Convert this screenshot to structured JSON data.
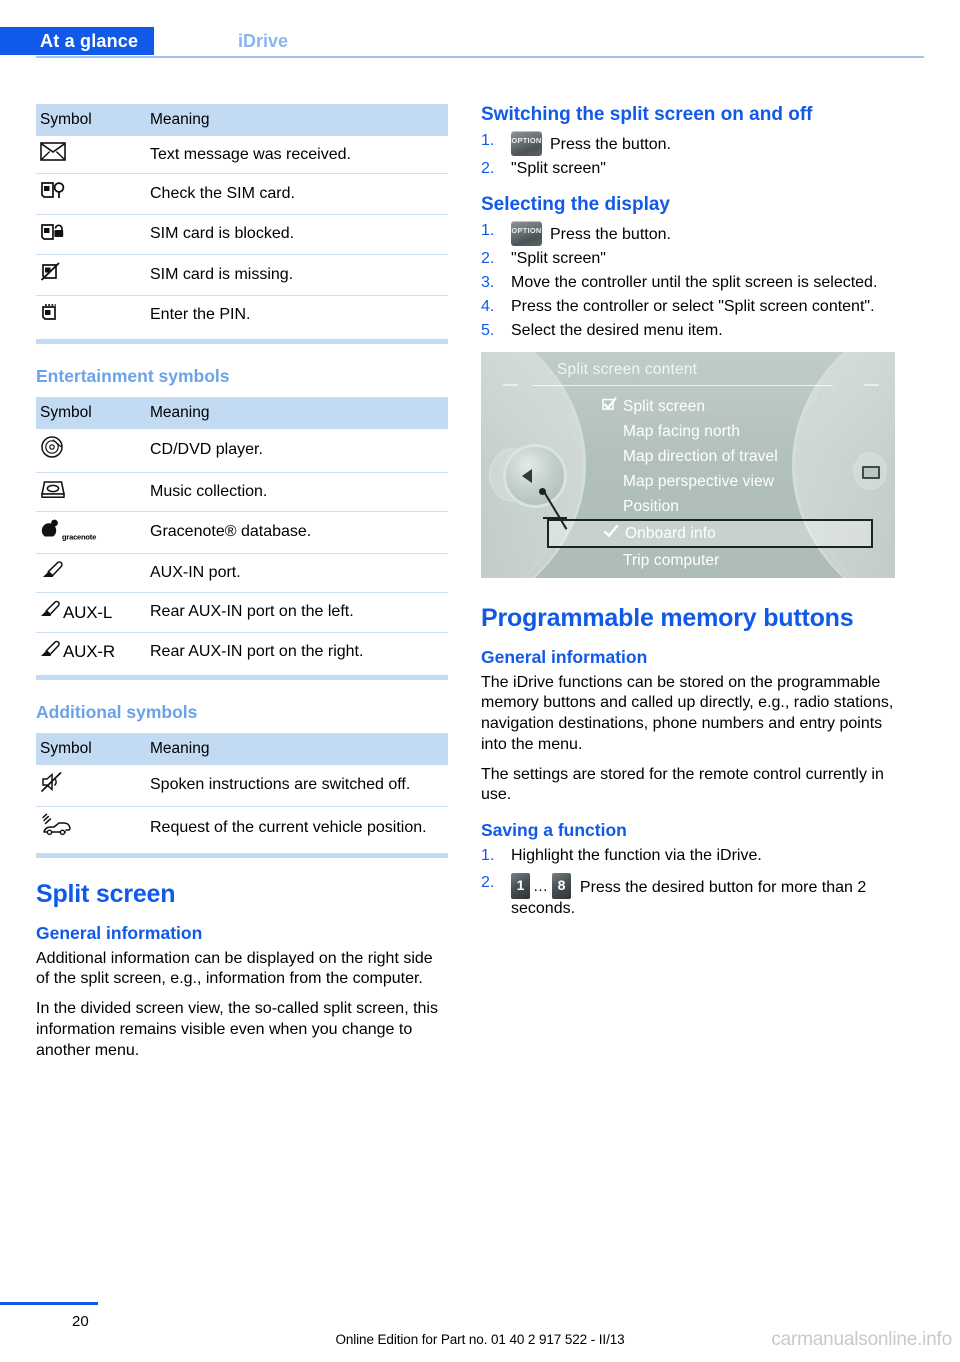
{
  "header": {
    "active_tab": "At a glance",
    "inactive_tab": "iDrive",
    "accent_color": "#1159e8",
    "inactive_color": "#8bb4ef"
  },
  "tables": {
    "col_headers": {
      "symbol": "Symbol",
      "meaning": "Meaning"
    },
    "phone_symbols": [
      {
        "icon": "envelope-icon",
        "meaning": "Text message was received."
      },
      {
        "icon": "sim-check-icon",
        "meaning": "Check the SIM card."
      },
      {
        "icon": "sim-locked-icon",
        "meaning": "SIM card is blocked."
      },
      {
        "icon": "sim-missing-icon",
        "meaning": "SIM card is missing."
      },
      {
        "icon": "sim-pin-icon",
        "meaning": "Enter the PIN."
      }
    ],
    "entertainment_symbols": [
      {
        "icon": "disc-icon",
        "label": "",
        "meaning": "CD/DVD player."
      },
      {
        "icon": "music-collection-icon",
        "label": "",
        "meaning": "Music collection."
      },
      {
        "icon": "gracenote-logo-icon",
        "label": "gracenote",
        "meaning": "Gracenote® database."
      },
      {
        "icon": "aux-plug-icon",
        "label": "",
        "meaning": "AUX-IN port."
      },
      {
        "icon": "aux-plug-icon",
        "label": "AUX-L",
        "meaning": "Rear AUX-IN port on the left."
      },
      {
        "icon": "aux-plug-icon",
        "label": "AUX-R",
        "meaning": "Rear AUX-IN port on the right."
      }
    ],
    "additional_symbols": [
      {
        "icon": "speaker-muted-icon",
        "meaning": "Spoken instructions are switched off."
      },
      {
        "icon": "vehicle-position-icon",
        "meaning": "Request of the current vehicle position."
      }
    ]
  },
  "left_column": {
    "entertainment_heading": "Entertainment symbols",
    "additional_heading": "Additional symbols",
    "split_screen_heading": "Split screen",
    "general_information_heading": "General information",
    "paragraph_1": "Additional information can be displayed on the right side of the split screen, e.g., information from the computer.",
    "paragraph_2": "In the divided screen view, the so-called split screen, this information remains visible even when you change to another menu."
  },
  "right_column": {
    "switching_heading": "Switching the split screen on and off",
    "switching_steps": [
      {
        "num": "1.",
        "glyph": "option-button",
        "glyph_label": "OPTION",
        "text": "Press the button."
      },
      {
        "num": "2.",
        "glyph": "",
        "glyph_label": "",
        "text": "\"Split screen\""
      }
    ],
    "selecting_heading": "Selecting the display",
    "selecting_steps": [
      {
        "num": "1.",
        "glyph": "option-button",
        "glyph_label": "OPTION",
        "text": "Press the button."
      },
      {
        "num": "2.",
        "glyph": "",
        "glyph_label": "",
        "text": "\"Split screen\""
      },
      {
        "num": "3.",
        "glyph": "",
        "glyph_label": "",
        "text": "Move the controller until the split screen is selected."
      },
      {
        "num": "4.",
        "glyph": "",
        "glyph_label": "",
        "text": "Press the controller or select \"Split screen content\"."
      },
      {
        "num": "5.",
        "glyph": "",
        "glyph_label": "",
        "text": "Select the desired menu item."
      }
    ],
    "memory_heading": "Programmable memory buttons",
    "memory_general_heading": "General information",
    "memory_paragraph_1": "The iDrive functions can be stored on the programmable memory buttons and called up directly, e.g., radio stations, navigation destinations, phone numbers and entry points into the menu.",
    "memory_paragraph_2": "The settings are stored for the remote control currently in use.",
    "saving_heading": "Saving a function",
    "saving_steps": [
      {
        "num": "1.",
        "text": "Highlight the function via the iDrive."
      },
      {
        "num": "2.",
        "text": "Press the desired button for more than 2 seconds."
      }
    ],
    "memory_button_first": "1",
    "memory_button_last": "8",
    "memory_button_ellipsis": "…"
  },
  "idrive_screen": {
    "title": "Split screen content",
    "items": [
      {
        "label": "Split screen",
        "mark": "checkbox-checked",
        "selected": false
      },
      {
        "label": "Map facing north",
        "mark": "",
        "selected": false
      },
      {
        "label": "Map direction of travel",
        "mark": "",
        "selected": false
      },
      {
        "label": "Map perspective view",
        "mark": "",
        "selected": false
      },
      {
        "label": "Position",
        "mark": "",
        "selected": false
      },
      {
        "label": "Onboard info",
        "mark": "check",
        "selected": true
      },
      {
        "label": "Trip computer",
        "mark": "",
        "selected": false
      }
    ]
  },
  "footer": {
    "page_number": "20",
    "edition": "Online Edition for Part no. 01 40 2 917 522 - II/13",
    "watermark": "carmanualsonline.info"
  }
}
